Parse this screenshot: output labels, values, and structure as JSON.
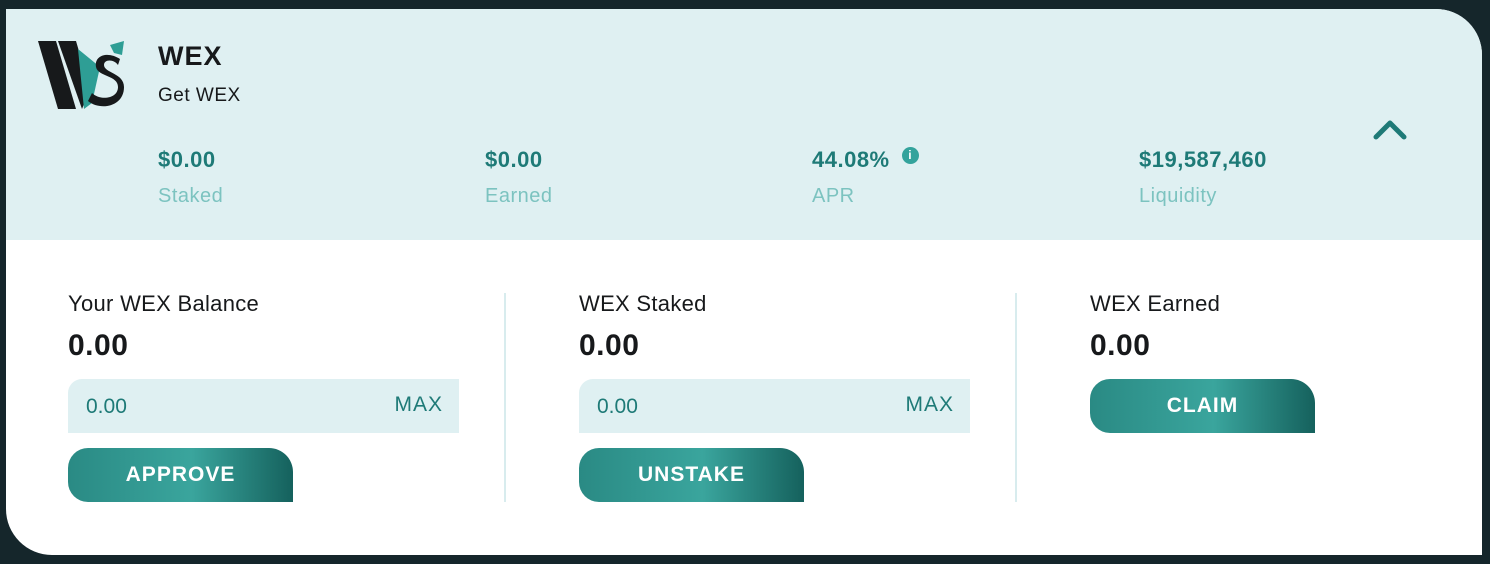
{
  "pool": {
    "name": "WEX",
    "subtitle": "Get WEX"
  },
  "stats": [
    {
      "value": "$0.00",
      "label": "Staked"
    },
    {
      "value": "$0.00",
      "label": "Earned"
    },
    {
      "value": "44.08%",
      "label": "APR",
      "has_info_icon": true
    },
    {
      "value": "$19,587,460",
      "label": "Liquidity"
    }
  ],
  "balance": {
    "title": "Your WEX Balance",
    "amount": "0.00",
    "input_placeholder": "0.00",
    "max_label": "MAX",
    "button_label": "APPROVE"
  },
  "staked": {
    "title": "WEX Staked",
    "amount": "0.00",
    "input_placeholder": "0.00",
    "max_label": "MAX",
    "button_label": "UNSTAKE"
  },
  "earned": {
    "title": "WEX Earned",
    "amount": "0.00",
    "button_label": "CLAIM"
  },
  "icons": {
    "logo": "wex-logo",
    "collapse": "chevron-up-icon",
    "info": "info-icon"
  },
  "colors": {
    "accent": "#1e7a77",
    "header_bg": "#dff0f2",
    "label": "#7cc3c0",
    "page_bg": "#15262b"
  }
}
